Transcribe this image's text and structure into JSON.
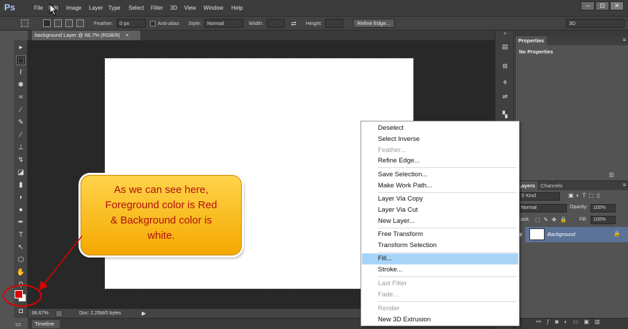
{
  "app": {
    "logo": "Ps"
  },
  "menu": [
    "File",
    "Edit",
    "Image",
    "Layer",
    "Type",
    "Select",
    "Filter",
    "3D",
    "View",
    "Window",
    "Help"
  ],
  "window_buttons": [
    "–",
    "⊡",
    "✕"
  ],
  "options": {
    "feather_label": "Feather:",
    "feather_value": "0 px",
    "antialias_label": "Anti-alias",
    "style_label": "Style:",
    "style_value": "Normal",
    "width_label": "Width:",
    "height_label": "Height:",
    "refine_edge": "Refine Edge...",
    "workspace": "3D"
  },
  "document": {
    "tab_label": "background Layer @ 66.7% (RGB/8)",
    "tab_close": "×"
  },
  "status": {
    "zoom": "66.67%",
    "doc_info": "Doc: 2.25M/0 bytes"
  },
  "timeline": {
    "label": "Timeline"
  },
  "properties": {
    "tab": "Properties",
    "content": "No Properties"
  },
  "layers": {
    "tabs": [
      "Layers",
      "Channels"
    ],
    "kind_label": "Kind",
    "blend_mode": "Normal",
    "opacity_label": "Opacity:",
    "opacity_value": "100%",
    "lock_label": "Lock:",
    "fill_label": "Fill:",
    "fill_value": "100%",
    "layer_name": "Background"
  },
  "context_menu": [
    {
      "label": "Deselect",
      "state": "enabled"
    },
    {
      "label": "Select Inverse",
      "state": "enabled"
    },
    {
      "label": "Feather...",
      "state": "disabled"
    },
    {
      "label": "Refine Edge...",
      "state": "enabled"
    },
    {
      "label": "Save Selection...",
      "state": "enabled"
    },
    {
      "label": "Make Work Path...",
      "state": "enabled"
    },
    {
      "label": "Layer Via Copy",
      "state": "enabled"
    },
    {
      "label": "Layer Via Cut",
      "state": "enabled"
    },
    {
      "label": "New Layer...",
      "state": "enabled"
    },
    {
      "label": "Free Transform",
      "state": "enabled"
    },
    {
      "label": "Transform Selection",
      "state": "enabled"
    },
    {
      "label": "Fill...",
      "state": "hover"
    },
    {
      "label": "Stroke...",
      "state": "enabled"
    },
    {
      "label": "Last Filter",
      "state": "disabled"
    },
    {
      "label": "Fade...",
      "state": "disabled"
    },
    {
      "label": "Render",
      "state": "disabled"
    },
    {
      "label": "New 3D Extrusion",
      "state": "enabled"
    }
  ],
  "colors": {
    "foreground": "#e00000",
    "background": "#ffffff",
    "menu_hover": "#a8d4f8"
  },
  "callout": {
    "line1": "As we can see here,",
    "line2": "Foreground color is Red",
    "line3": "& Background color is",
    "line4": "white."
  }
}
